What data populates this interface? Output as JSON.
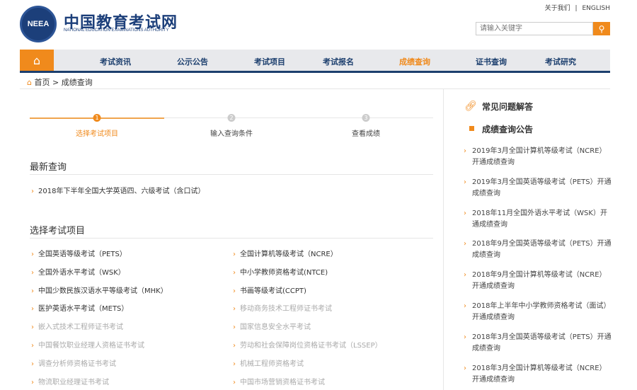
{
  "header": {
    "about": "关于我们",
    "sep": "|",
    "english": "ENGLISH",
    "logo_text": "NEEA",
    "title": "中国教育考试网",
    "subtitle": "NATIONAL EDUCATION EXAMINATIONS AUTHORITY",
    "search_placeholder": "请输入关键字"
  },
  "nav": [
    "考试资讯",
    "公示公告",
    "考试项目",
    "考试报名",
    "成绩查询",
    "证书查询",
    "考试研究"
  ],
  "nav_active": "成绩查询",
  "breadcrumb": {
    "home": "首页",
    "sep": ">",
    "current": "成绩查询"
  },
  "steps": [
    {
      "num": "1",
      "label": "选择考试项目"
    },
    {
      "num": "2",
      "label": "输入查询条件"
    },
    {
      "num": "3",
      "label": "查看成绩"
    }
  ],
  "latest": {
    "title": "最新查询",
    "items": [
      "2018年下半年全国大学英语四、六级考试（含口试）"
    ]
  },
  "select": {
    "title": "选择考试项目",
    "items": [
      {
        "label": "全国英语等级考试（PETS）",
        "enabled": true
      },
      {
        "label": "全国计算机等级考试（NCRE）",
        "enabled": true
      },
      {
        "label": "全国外语水平考试（WSK）",
        "enabled": true
      },
      {
        "label": "中小学教师资格考试(NTCE)",
        "enabled": true
      },
      {
        "label": "中国少数民族汉语水平等级考试（MHK）",
        "enabled": true
      },
      {
        "label": "书画等级考试(CCPT)",
        "enabled": true
      },
      {
        "label": "医护英语水平考试（METS）",
        "enabled": true
      },
      {
        "label": "移动商务技术工程师证书考试",
        "enabled": false
      },
      {
        "label": "嵌入式技术工程师证书考试",
        "enabled": false
      },
      {
        "label": "国家信息安全水平考试",
        "enabled": false
      },
      {
        "label": "中国餐饮职业经理人资格证书考试",
        "enabled": false
      },
      {
        "label": "劳动和社会保障岗位资格证书考试（LSSEP）",
        "enabled": false
      },
      {
        "label": "调查分析师资格证书考试",
        "enabled": false
      },
      {
        "label": "机械工程师资格考试",
        "enabled": false
      },
      {
        "label": "物流职业经理证书考试",
        "enabled": false
      },
      {
        "label": "中国市场营销资格证书考试",
        "enabled": false
      }
    ]
  },
  "sidebar": {
    "faq": "常见问题解答",
    "notice_title": "成绩查询公告",
    "notices": [
      "2019年3月全国计算机等级考试（NCRE）开通成绩查询",
      "2019年3月全国英语等级考试（PETS）开通成绩查询",
      "2018年11月全国外语水平考试（WSK）开通成绩查询",
      "2018年9月全国英语等级考试（PETS）开通成绩查询",
      "2018年9月全国计算机等级考试（NCRE）开通成绩查询",
      "2018年上半年中小学教师资格考试（面试）开通成绩查询",
      "2018年3月全国英语等级考试（PETS）开通成绩查询",
      "2018年3月全国计算机等级考试（NCRE）开通成绩查询"
    ]
  },
  "colors": {
    "accent": "#f08a1c",
    "navy": "#1c3f6e"
  }
}
